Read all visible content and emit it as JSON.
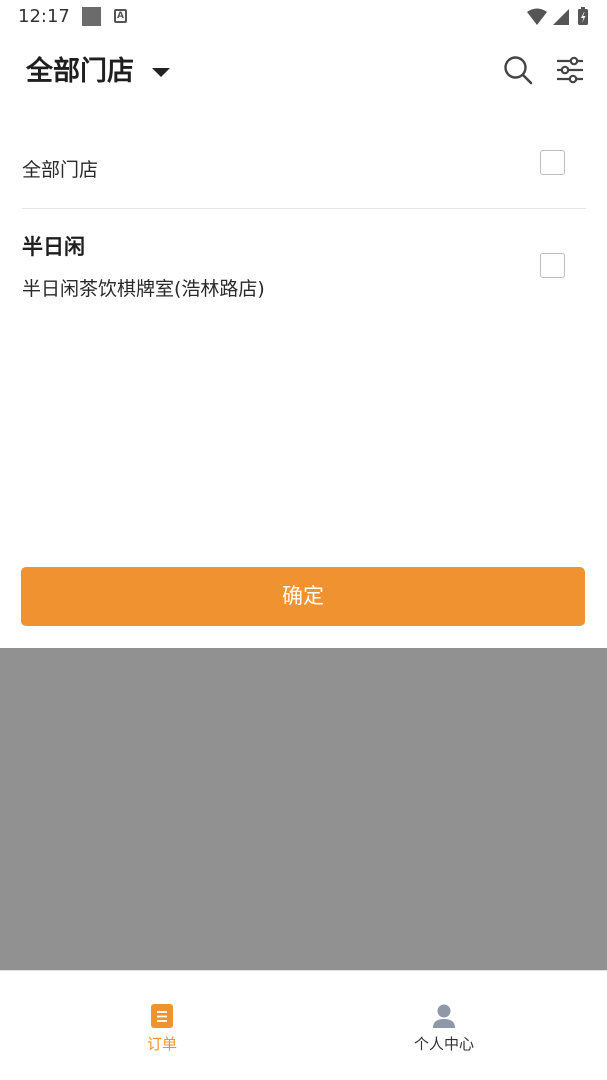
{
  "status_bar": {
    "time": "12:17",
    "icons": [
      "notification-square-icon",
      "font-a-icon",
      "wifi-icon",
      "signal-icon",
      "battery-icon"
    ]
  },
  "header": {
    "title": "全部门店",
    "icons": [
      "dropdown-caret-icon",
      "search-icon",
      "filter-sliders-icon"
    ]
  },
  "store_list": {
    "all_label": "全部门店",
    "brands": [
      {
        "name": "半日闲",
        "branch": "半日闲茶饮棋牌室(浩林路店)"
      }
    ]
  },
  "confirm": {
    "label": "确定"
  },
  "bottom_nav": {
    "items": [
      {
        "label": "订单",
        "icon": "orders-icon",
        "active": true
      },
      {
        "label": "个人中心",
        "icon": "person-icon",
        "active": false
      }
    ]
  },
  "colors": {
    "accent": "#f0922f",
    "overlay": "#919191",
    "checkbox_border": "#bdbdbd",
    "inactive_icon": "#8f98a8"
  }
}
